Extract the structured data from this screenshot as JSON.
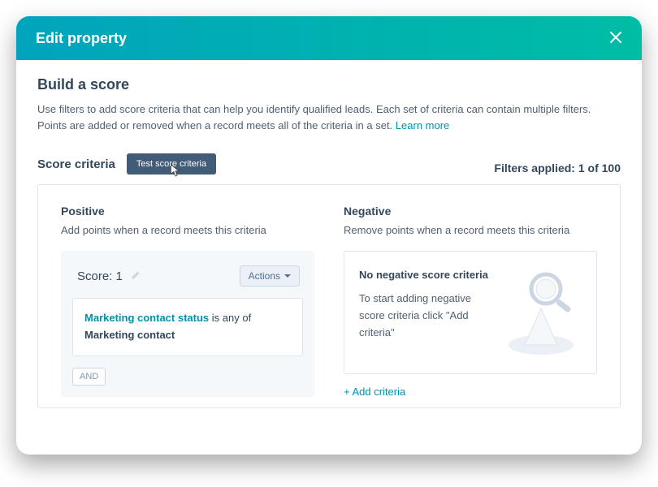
{
  "header": {
    "title": "Edit property"
  },
  "build": {
    "title": "Build a score",
    "intro": "Use filters to add score criteria that can help you identify qualified leads. Each set of criteria can contain multiple filters. Points are added or removed when a record meets all of the criteria in a set.",
    "learn_more": "Learn more"
  },
  "criteria": {
    "label": "Score criteria",
    "test_button": "Test score criteria",
    "filters_applied": "Filters applied: 1 of 100"
  },
  "positive": {
    "title": "Positive",
    "sub": "Add points when a record meets this criteria",
    "score_prefix": "Score: ",
    "score_value": "1",
    "actions_label": "Actions",
    "filter_property": "Marketing contact status",
    "filter_connector": " is any of ",
    "filter_value": "Marketing contact",
    "and_chip": "AND"
  },
  "negative": {
    "title": "Negative",
    "sub": "Remove points when a record meets this criteria",
    "empty_title": "No negative score criteria",
    "empty_desc": "To start adding negative score criteria click \"Add criteria\"",
    "add_link": "+ Add criteria"
  }
}
